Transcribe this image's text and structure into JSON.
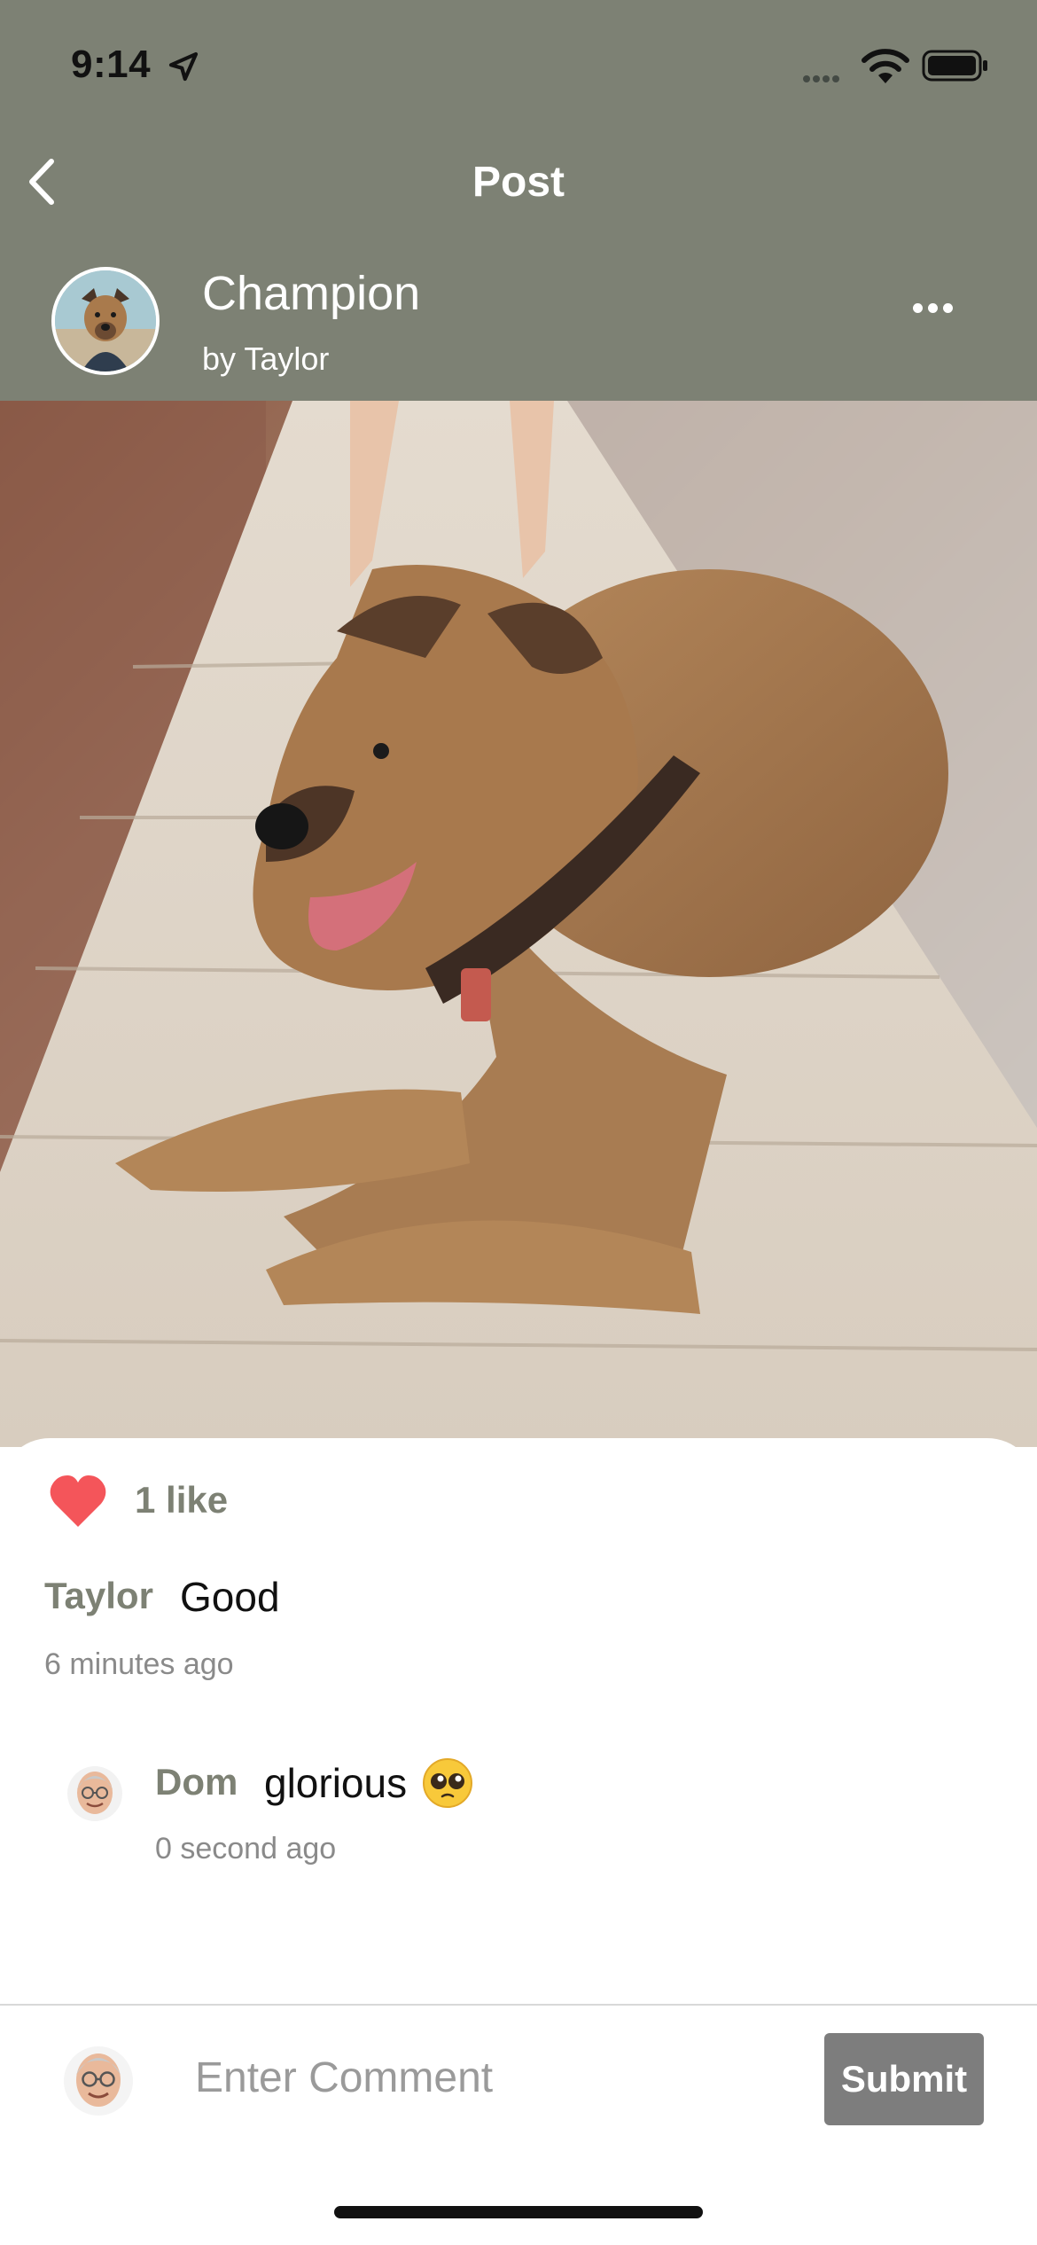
{
  "status_bar": {
    "time": "9:14",
    "icons": [
      "location-arrow-icon",
      "cellular-signal-icon",
      "wifi-icon",
      "battery-icon"
    ]
  },
  "nav": {
    "title": "Post",
    "back_icon": "chevron-left-icon"
  },
  "post": {
    "name": "Champion",
    "author": "by Taylor",
    "more_icon": "more-horizontal-icon",
    "photo_subject": "dog"
  },
  "likes": {
    "icon": "heart-icon",
    "count_label": "1 like"
  },
  "caption": {
    "user": "Taylor",
    "text": "Good",
    "time": "6 minutes ago"
  },
  "comments": [
    {
      "user": "Dom",
      "text": "glorious",
      "emoji": "pleading-face-emoji",
      "time": "0 second ago"
    }
  ],
  "composer": {
    "placeholder": "Enter Comment",
    "value": "",
    "submit_label": "Submit"
  },
  "colors": {
    "header_bg": "#7d8174",
    "like_heart": "#f4555a",
    "username": "#7d8174",
    "submit_bg": "#7d7d7d"
  }
}
